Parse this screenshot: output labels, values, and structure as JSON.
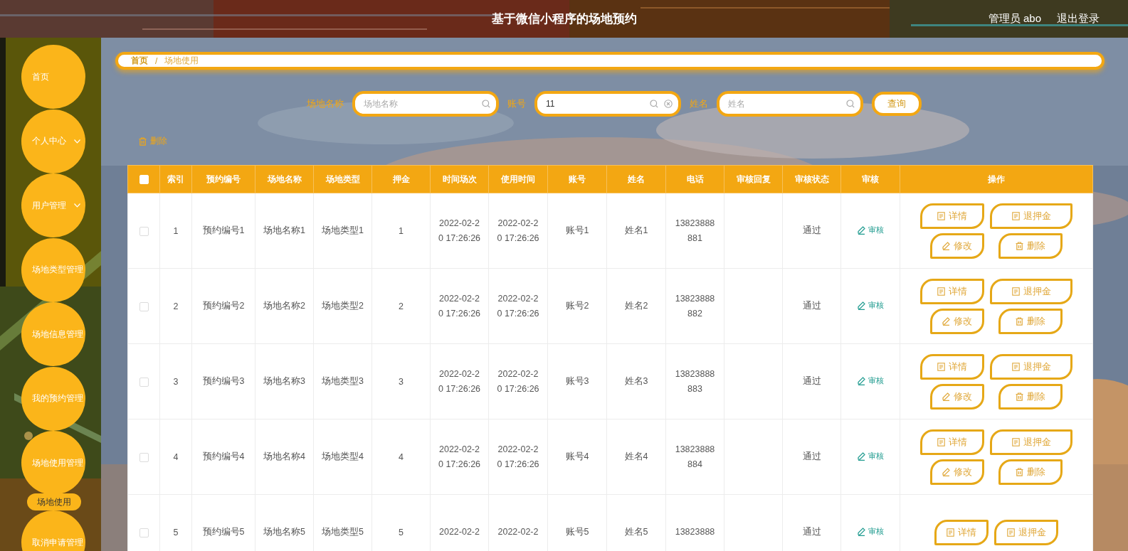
{
  "header": {
    "title": "基于微信小程序的场地预约",
    "user": "管理员 abo",
    "logout": "退出登录"
  },
  "sidebar": {
    "items": [
      {
        "label": "首页",
        "kind": "link"
      },
      {
        "label": "个人中心",
        "kind": "submenu",
        "expanded": false
      },
      {
        "label": "用户管理",
        "kind": "submenu",
        "expanded": false
      },
      {
        "label": "场地类型管理",
        "kind": "link"
      },
      {
        "label": "场地信息管理",
        "kind": "link"
      },
      {
        "label": "我的预约管理",
        "kind": "link"
      },
      {
        "label": "场地使用管理",
        "kind": "submenu",
        "expanded": true,
        "children": [
          {
            "label": "场地使用"
          }
        ]
      },
      {
        "label": "取消申请管理",
        "kind": "link"
      }
    ]
  },
  "breadcrumb": {
    "items": [
      "首页",
      "场地使用"
    ],
    "separator": "/"
  },
  "search": {
    "fields": [
      {
        "label": "场地名称",
        "placeholder": "场地名称"
      },
      {
        "label": "账号",
        "value": "11"
      },
      {
        "label": "姓名",
        "placeholder": "姓名"
      }
    ],
    "button": "查询"
  },
  "delete_button": "删除",
  "table": {
    "select_all_checked": false,
    "columns": [
      "索引",
      "预约编号",
      "场地名称",
      "场地类型",
      "押金",
      "时间场次",
      "使用时间",
      "账号",
      "姓名",
      "电话",
      "审核回复",
      "审核状态",
      "审核",
      "操作"
    ],
    "rows": [
      {
        "checked": false,
        "cells": [
          "1",
          "预约编号1",
          "场地名称1",
          "场地类型1",
          "1",
          "2022-02-20 17:26:26",
          "2022-02-20 17:26:26",
          "账号1",
          "姓名1",
          "13823888881",
          "",
          "通过"
        ],
        "review": "审核",
        "actions": [
          "详情",
          "退押金",
          "修改",
          "删除"
        ]
      },
      {
        "checked": false,
        "cells": [
          "2",
          "预约编号2",
          "场地名称2",
          "场地类型2",
          "2",
          "2022-02-20 17:26:26",
          "2022-02-20 17:26:26",
          "账号2",
          "姓名2",
          "13823888882",
          "",
          "通过"
        ],
        "review": "审核",
        "actions": [
          "详情",
          "退押金",
          "修改",
          "删除"
        ]
      },
      {
        "checked": false,
        "cells": [
          "3",
          "预约编号3",
          "场地名称3",
          "场地类型3",
          "3",
          "2022-02-20 17:26:26",
          "2022-02-20 17:26:26",
          "账号3",
          "姓名3",
          "13823888883",
          "",
          "通过"
        ],
        "review": "审核",
        "actions": [
          "详情",
          "退押金",
          "修改",
          "删除"
        ]
      },
      {
        "checked": false,
        "cells": [
          "4",
          "预约编号4",
          "场地名称4",
          "场地类型4",
          "4",
          "2022-02-20 17:26:26",
          "2022-02-20 17:26:26",
          "账号4",
          "姓名4",
          "13823888884",
          "",
          "通过"
        ],
        "review": "审核",
        "actions": [
          "详情",
          "退押金",
          "修改",
          "删除"
        ]
      },
      {
        "checked": false,
        "cells": [
          "5",
          "预约编号5",
          "场地名称5",
          "场地类型5",
          "5",
          "2022-02-2",
          "2022-02-2",
          "账号5",
          "姓名5",
          "13823888",
          "",
          "通过"
        ],
        "review": "审核",
        "actions": [
          "详情",
          "退押金"
        ]
      }
    ]
  }
}
